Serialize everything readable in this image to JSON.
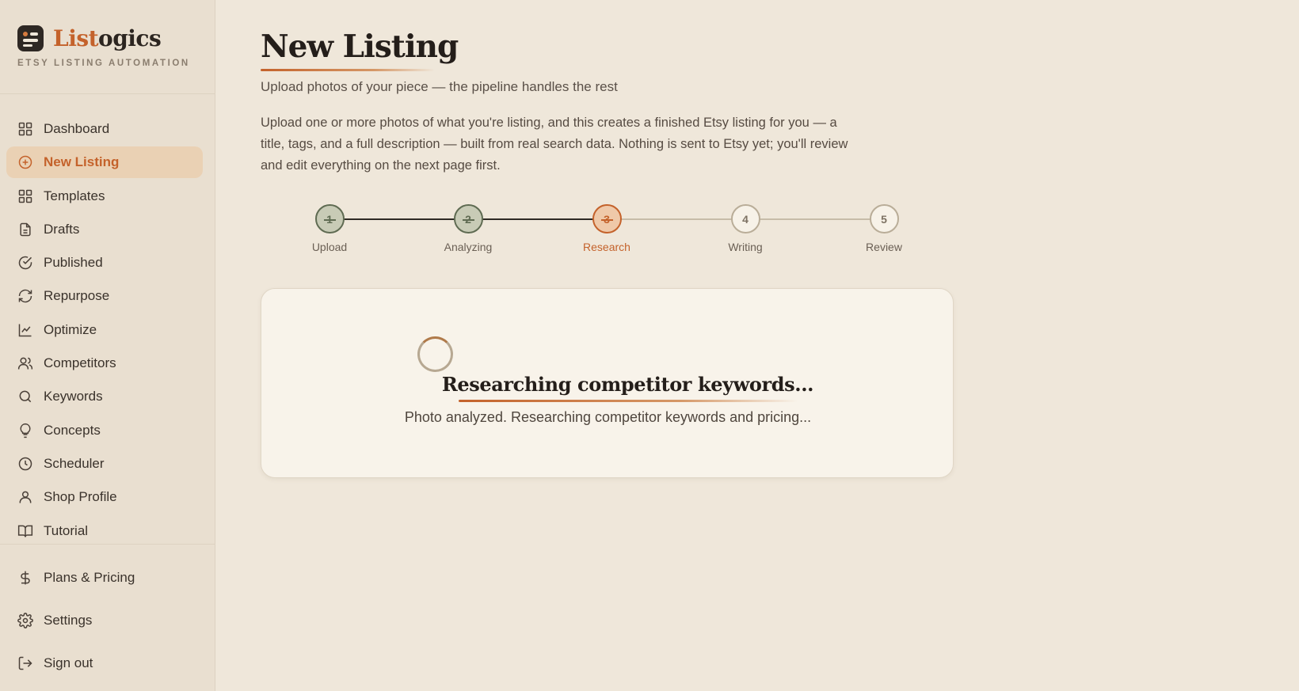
{
  "brand": {
    "name_part1": "List",
    "name_part2": "ogics",
    "tagline": "ETSY LISTING AUTOMATION"
  },
  "sidebar": {
    "items": [
      {
        "label": "Dashboard",
        "icon": "grid-icon",
        "active": false
      },
      {
        "label": "New Listing",
        "icon": "plus-circle-icon",
        "active": true
      },
      {
        "label": "Templates",
        "icon": "grid-icon",
        "active": false
      },
      {
        "label": "Drafts",
        "icon": "file-icon",
        "active": false
      },
      {
        "label": "Published",
        "icon": "check-circle-icon",
        "active": false
      },
      {
        "label": "Repurpose",
        "icon": "refresh-icon",
        "active": false
      },
      {
        "label": "Optimize",
        "icon": "line-chart-icon",
        "active": false
      },
      {
        "label": "Competitors",
        "icon": "users-icon",
        "active": false
      },
      {
        "label": "Keywords",
        "icon": "search-icon",
        "active": false
      },
      {
        "label": "Concepts",
        "icon": "lightbulb-icon",
        "active": false
      },
      {
        "label": "Scheduler",
        "icon": "clock-icon",
        "active": false
      },
      {
        "label": "Shop Profile",
        "icon": "user-icon",
        "active": false
      },
      {
        "label": "Tutorial",
        "icon": "book-icon",
        "active": false
      }
    ],
    "lower_items": [
      {
        "label": "Plans & Pricing",
        "icon": "dollar-icon"
      },
      {
        "label": "Settings",
        "icon": "gear-icon"
      },
      {
        "label": "Sign out",
        "icon": "sign-out-icon"
      }
    ]
  },
  "page": {
    "title": "New Listing",
    "subtitle": "Upload photos of your piece — the pipeline handles the rest",
    "intro": "Upload one or more photos of what you're listing, and this creates a finished Etsy listing for you — a title, tags, and a full description — built from real search data. Nothing is sent to Etsy yet; you'll review and edit everything on the next page first."
  },
  "stepper": {
    "steps": [
      {
        "number": "1",
        "label": "Upload",
        "state": "done"
      },
      {
        "number": "2",
        "label": "Analyzing",
        "state": "done"
      },
      {
        "number": "3",
        "label": "Research",
        "state": "current"
      },
      {
        "number": "4",
        "label": "Writing",
        "state": "pending"
      },
      {
        "number": "5",
        "label": "Review",
        "state": "pending"
      }
    ]
  },
  "status_card": {
    "title": "Researching competitor keywords...",
    "message": "Photo analyzed. Researching competitor keywords and pricing..."
  },
  "colors": {
    "accent": "#c4622b",
    "background": "#efe7da",
    "sidebar": "#e9dfd0",
    "done": "#5f6b52"
  }
}
